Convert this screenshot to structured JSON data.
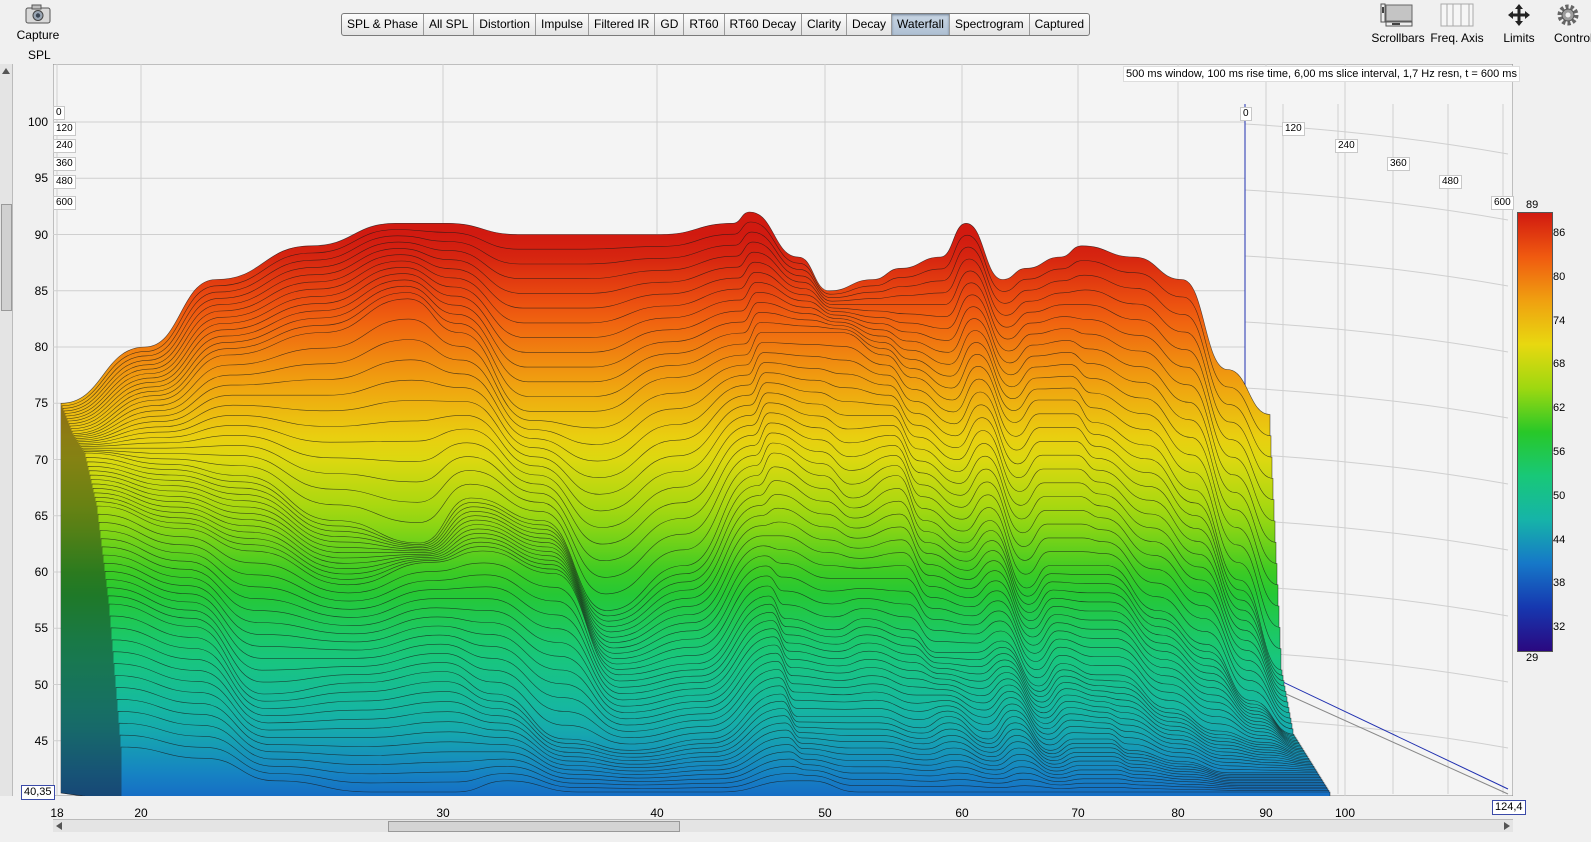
{
  "toolbar": {
    "capture_label": "Capture",
    "tabs": [
      "SPL & Phase",
      "All SPL",
      "Distortion",
      "Impulse",
      "Filtered IR",
      "GD",
      "RT60",
      "RT60 Decay",
      "Clarity",
      "Decay",
      "Waterfall",
      "Spectrogram",
      "Captured"
    ],
    "active_tab": "Waterfall",
    "right_tools": {
      "scrollbars": "Scrollbars",
      "freq_axis": "Freq. Axis",
      "limits": "Limits",
      "controls": "Controls"
    }
  },
  "plot": {
    "y_axis_label": "SPL",
    "info_text": "500 ms window, 100 ms rise time, 6,00 ms slice interval, 1,7 Hz resn, t = 600 ms",
    "y_ticks": [
      "100",
      "95",
      "90",
      "85",
      "80",
      "75",
      "70",
      "65",
      "60",
      "55",
      "50",
      "45"
    ],
    "x_ticks": [
      "18",
      "20",
      "30",
      "40",
      "50",
      "60",
      "70",
      "80",
      "90",
      "100"
    ],
    "time_ticks": [
      "0",
      "120",
      "240",
      "360",
      "480",
      "600"
    ],
    "y_min_box": "40,35",
    "x_max_box": "124,4"
  },
  "colorbar": {
    "max": "89",
    "min": "29",
    "ticks": [
      "86",
      "80",
      "74",
      "68",
      "62",
      "56",
      "50",
      "44",
      "38",
      "32"
    ],
    "colors": [
      "#d11a10",
      "#f05a10",
      "#f0a010",
      "#e8d810",
      "#9ed810",
      "#28c828",
      "#18c878",
      "#16b4a8",
      "#1678c8",
      "#1638b0",
      "#2a0880"
    ]
  },
  "chart_data": {
    "type": "area",
    "title": "",
    "xlabel": "",
    "ylabel": "SPL",
    "xscale": "log",
    "xlim": [
      18,
      124.4
    ],
    "ylim": [
      40.35,
      104
    ],
    "zlabel": "",
    "zlim": [
      0,
      600
    ],
    "x": [
      18,
      20,
      22,
      25,
      28,
      30,
      33,
      36,
      40,
      44,
      45,
      48,
      50,
      53,
      55,
      58,
      60,
      63,
      65,
      68,
      70,
      75,
      80,
      85,
      90
    ],
    "series": [
      {
        "name": "0",
        "values": [
          75,
          80,
          86,
          89,
          91,
          91,
          90,
          90,
          90,
          91,
          92,
          88,
          85,
          86,
          87,
          88,
          91,
          86,
          87,
          88,
          89,
          88,
          86,
          78,
          74
        ]
      },
      {
        "name": "120",
        "values": [
          73,
          76,
          80,
          82,
          85,
          82,
          75,
          75,
          78,
          80,
          82,
          82,
          82,
          80,
          78,
          76,
          79,
          74,
          76,
          76,
          74,
          72,
          68,
          60,
          52
        ]
      },
      {
        "name": "240",
        "values": [
          72,
          71,
          70,
          66,
          64,
          68,
          66,
          58,
          62,
          70,
          72,
          70,
          68,
          70,
          66,
          64,
          66,
          60,
          62,
          62,
          62,
          58,
          55,
          50,
          47
        ]
      },
      {
        "name": "360",
        "values": [
          68,
          66,
          64,
          61,
          63,
          64,
          62,
          53,
          54,
          60,
          58,
          57,
          58,
          57,
          55,
          55,
          56,
          52,
          54,
          53,
          53,
          50,
          48,
          47,
          46
        ]
      },
      {
        "name": "480",
        "values": [
          60,
          58,
          52,
          53,
          54,
          52,
          48,
          47,
          48,
          52,
          50,
          50,
          50,
          49,
          50,
          48,
          50,
          47,
          48,
          48,
          47,
          46,
          45,
          45,
          45
        ]
      },
      {
        "name": "600",
        "values": [
          48,
          47,
          45,
          44,
          44,
          45,
          44,
          44,
          44,
          45,
          45,
          44,
          44,
          44,
          44,
          44,
          44,
          44,
          44,
          44,
          44,
          44,
          44,
          44,
          44
        ]
      }
    ]
  }
}
